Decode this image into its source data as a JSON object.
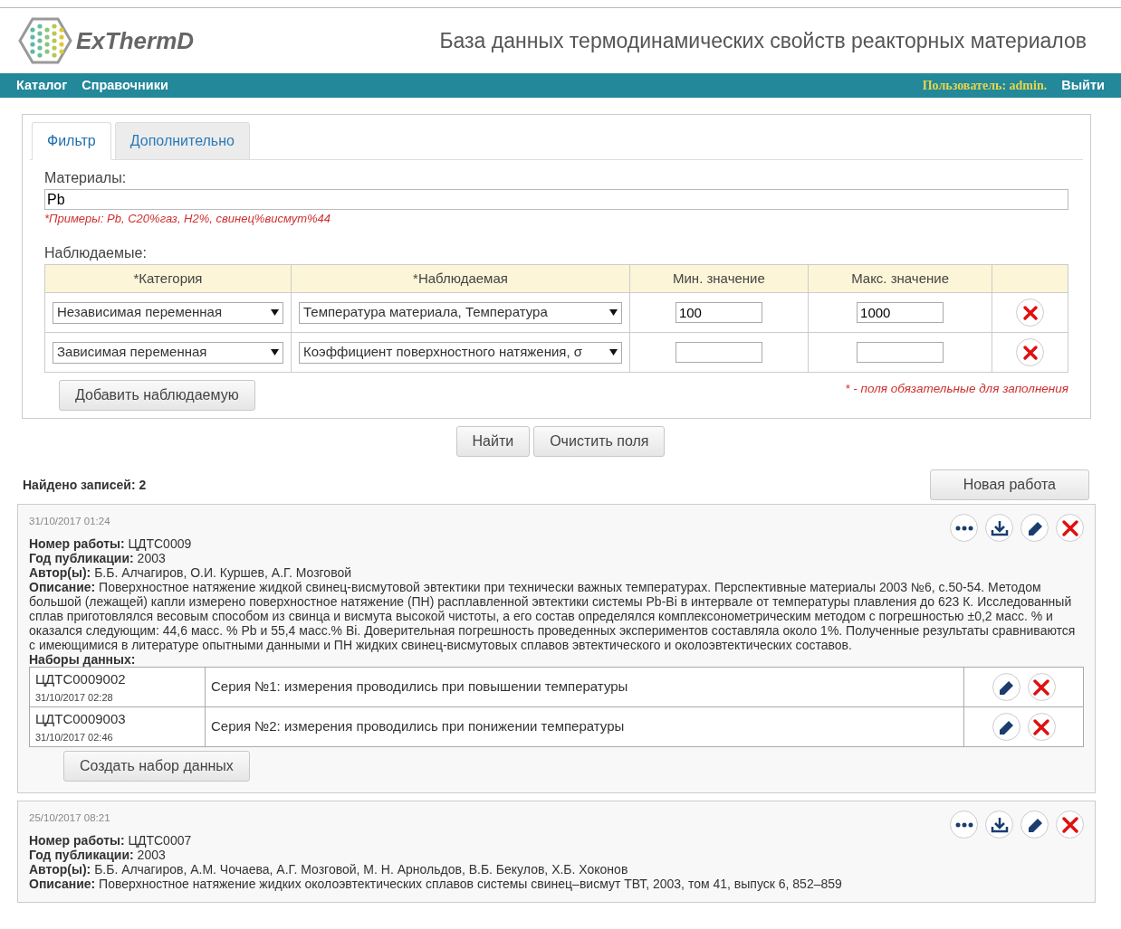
{
  "header": {
    "logo": "ExThermD",
    "title": "База данных термодинамических свойств реакторных материалов"
  },
  "nav": {
    "items": [
      "Каталог",
      "Справочники"
    ],
    "user": "Пользователь: admin.",
    "logout": "Выйти"
  },
  "tabs": [
    {
      "label": "Фильтр",
      "selected": true
    },
    {
      "label": "Дополнительно",
      "selected": false
    }
  ],
  "filter": {
    "materials_label": "Материалы:",
    "materials_value": "Pb",
    "hint": "*Примеры: Pb, C20%газ, H2%, свинец%висмут%44",
    "observables_label": "Наблюдаемые:",
    "columns": [
      "*Категория",
      "*Наблюдаемая",
      "Мин. значение",
      "Макс. значение"
    ],
    "rows": [
      {
        "category": "Независимая переменная",
        "observable": "Температура материала, Температура",
        "min": "100",
        "max": "1000"
      },
      {
        "category": "Зависимая переменная",
        "observable": "Коэффициент поверхностного натяжения, σ",
        "min": "",
        "max": ""
      }
    ],
    "add_button": "Добавить наблюдаемую",
    "required_note": "* - поля обязательные для заполнения"
  },
  "actions": [
    "Найти",
    "Очистить поля"
  ],
  "found": "Найдено записей: 2",
  "new_button": "Новая работа",
  "works": [
    {
      "date": "31/10/2017 01:24",
      "lines": [
        "**Номер работы:** ЦДТС0009",
        "**Год публикации:** 2003",
        "**Автор(ы):** Б.Б. Алчагиров, О.И. Куршев, А.Г. Мозговой",
        "**Описание:** Поверхностное натяжение жидкой свинец-висмутовой эвтектики при технически важных температурах. Перспективные материалы 2003 №6, с.50-54. Методом большой (лежащей) капли измерено поверхностное натяжение (ПН) расплавленной эвтектики системы Pb-Bi в интервале от температуры плавления до 623 К. Исследованный сплав приготовлялся весовым способом из свинца и висмута высокой чистоты, а его состав определялся комплексонометрическим методом с погрешностью ±0,2 масс. % и оказался следующим: 44,6 масс. % Pb и 55,4 масс.% Bi. Доверительная погрешность проведенных экспериментов составляла около 1%. Полученные результаты сравниваются с имеющимися в литературе опытными данными и ПН жидких свинец-висмутовых сплавов эвтектического и околоэвтектических составов."
      ],
      "datasets_label": "Наборы данных:",
      "datasets": [
        {
          "code": "ЦДТС0009002",
          "date": "31/10/2017 02:28",
          "title": "Серия №1: измерения проводились при повышении температуры"
        },
        {
          "code": "ЦДТС0009003",
          "date": "31/10/2017 02:46",
          "title": "Серия №2: измерения проводились при понижении температуры"
        }
      ],
      "create_button": "Создать набор данных"
    },
    {
      "date": "25/10/2017 08:21",
      "lines": [
        "**Номер работы:** ЦДТС0007",
        "**Год публикации:** 2003",
        "**Автор(ы):** Б.Б. Алчагиров, А.М. Чочаева, А.Г. Мозговой, М. Н. Арнольдов, В.Б. Бекулов, Х.Б. Хоконов",
        "**Описание:** Поверхностное натяжение жидких околоэвтектических сплавов системы свинец–висмут ТВТ, 2003, том 41, выпуск 6, 852–859"
      ]
    }
  ]
}
